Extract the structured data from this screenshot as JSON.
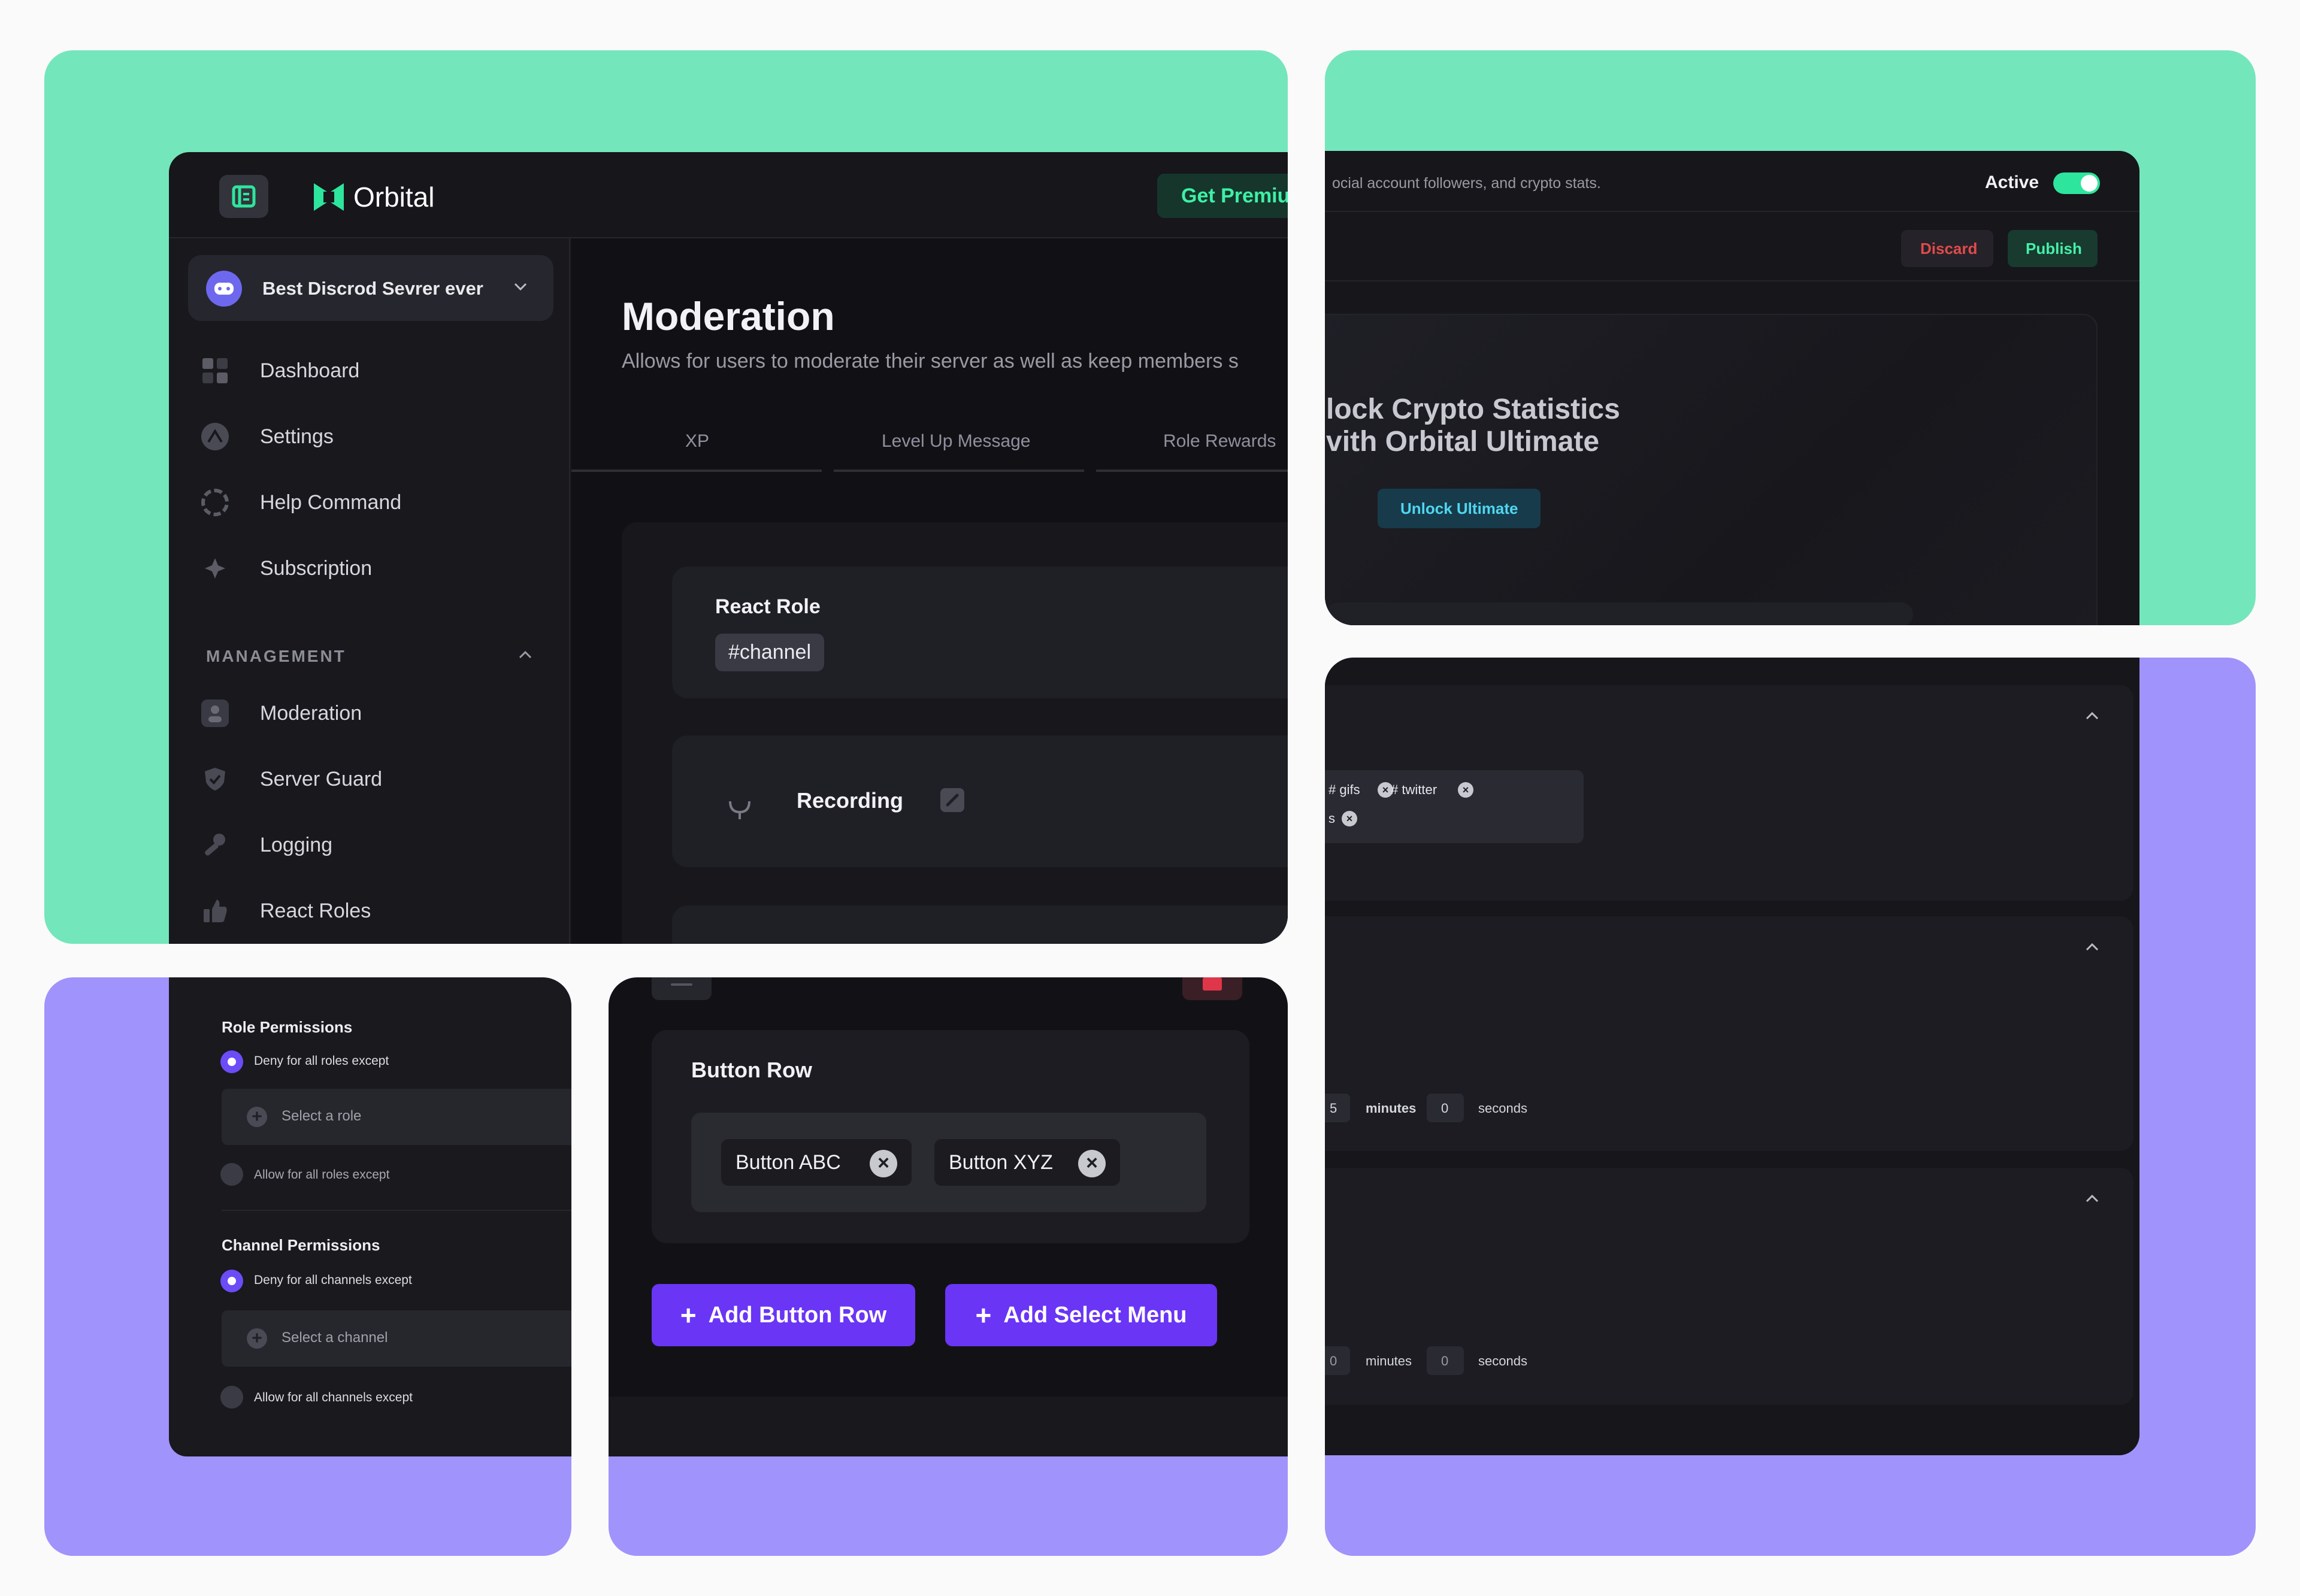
{
  "brand": {
    "name": "Orbital",
    "premium_label": "Get Premium"
  },
  "server_selector": {
    "name": "Best Discrod Sevrer ever"
  },
  "sidebar": {
    "items": [
      {
        "label": "Dashboard",
        "icon": "dashboard-icon"
      },
      {
        "label": "Settings",
        "icon": "settings-icon"
      },
      {
        "label": "Help Command",
        "icon": "help-icon"
      },
      {
        "label": "Subscription",
        "icon": "sparkle-icon"
      }
    ],
    "section_title": "MANAGEMENT",
    "management_items": [
      {
        "label": "Moderation",
        "icon": "user-icon"
      },
      {
        "label": "Server Guard",
        "icon": "shield-icon"
      },
      {
        "label": "Logging",
        "icon": "wrench-icon"
      },
      {
        "label": "React Roles",
        "icon": "thumbs-up-icon"
      }
    ]
  },
  "main": {
    "title": "Moderation",
    "description": "Allows for users to moderate their server as well as keep members s",
    "tabs": [
      "XP",
      "Level Up Message",
      "Role Rewards"
    ],
    "react_role": {
      "title": "React Role",
      "channel_tag": "#channel"
    },
    "recording": {
      "label": "Recording"
    }
  },
  "upsell": {
    "description": "ocial account followers, and crypto stats.",
    "active_label": "Active",
    "active": true,
    "discard_label": "Discard",
    "publish_label": "Publish",
    "headline_line1": "lock Crypto Statistics",
    "headline_line2": "vith Orbital Ultimate",
    "unlock_label": "Unlock Ultimate"
  },
  "filters": {
    "tags": [
      {
        "label": "# gifs"
      },
      {
        "label": "# twitter"
      },
      {
        "label": "s"
      }
    ],
    "timer1": {
      "minutes": "5",
      "minutes_label": "minutes",
      "seconds": "0",
      "seconds_label": "seconds"
    },
    "timer2": {
      "minutes": "0",
      "minutes_label": "minutes",
      "seconds": "0",
      "seconds_label": "seconds"
    }
  },
  "permissions": {
    "role_title": "Role Permissions",
    "role_deny": "Deny for all roles except",
    "role_select": "Select a role",
    "role_allow": "Allow for all roles except",
    "channel_title": "Channel Permissions",
    "channel_deny": "Deny for all channels except",
    "channel_select": "Select a channel",
    "channel_allow": "Allow for all channels except"
  },
  "buttons": {
    "row_title": "Button Row",
    "chips": [
      "Button ABC",
      "Button XYZ"
    ],
    "add_row_label": "Add Button Row",
    "add_menu_label": "Add Select Menu"
  },
  "colors": {
    "green": "#74e6bb",
    "purple": "#a093fb",
    "accent": "#6a35f5",
    "panel": "#16161b",
    "card": "#1e1e25",
    "brand_green": "#2ee59d"
  }
}
